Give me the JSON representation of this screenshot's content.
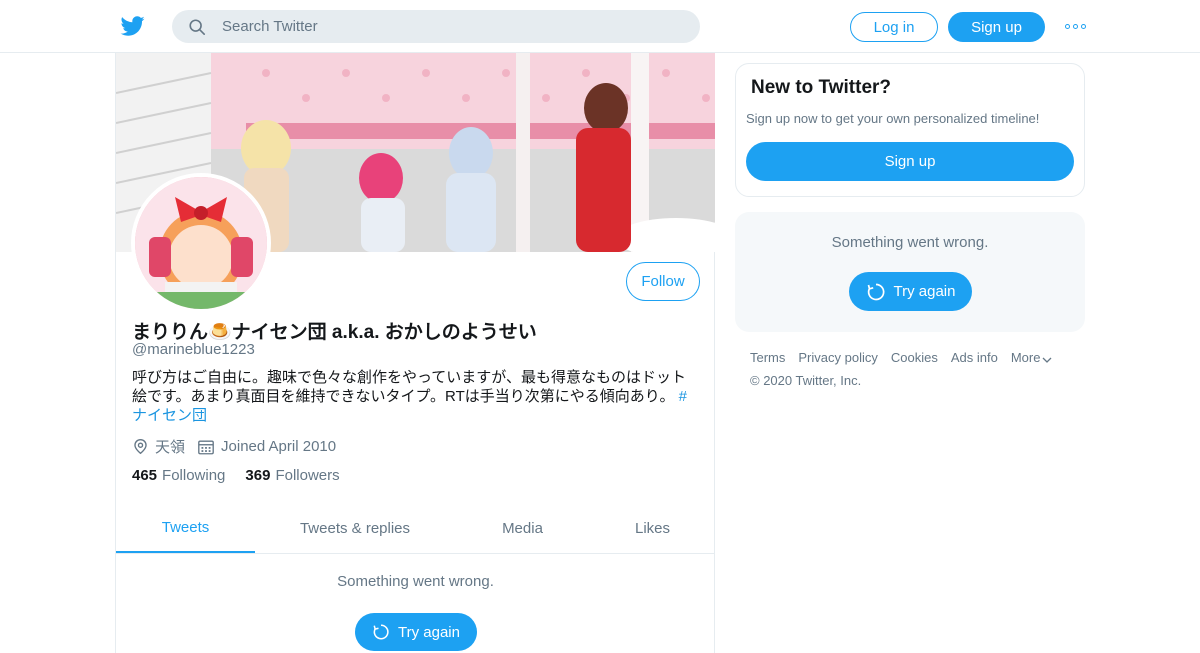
{
  "header": {
    "search_placeholder": "Search Twitter",
    "login_label": "Log in",
    "signup_label": "Sign up"
  },
  "profile": {
    "display_name": "まりりん🍮ナイセン団 a.k.a. おかしのようせい",
    "handle": "@marineblue1223",
    "bio_text": "呼び方はご自由に。趣味で色々な創作をやっていますが、最も得意なものはドット絵です。あまり真面目を維持できないタイプ。RTは手当り次第にやる傾向あり。",
    "bio_hashtag": "#ナイセン団",
    "location": "天領",
    "joined": "Joined April 2010",
    "following_count": "465",
    "following_label": "Following",
    "followers_count": "369",
    "followers_label": "Followers",
    "follow_label": "Follow"
  },
  "tabs": [
    {
      "label": "Tweets",
      "active": true
    },
    {
      "label": "Tweets & replies",
      "active": false
    },
    {
      "label": "Media",
      "active": false
    },
    {
      "label": "Likes",
      "active": false
    }
  ],
  "timeline": {
    "error_text": "Something went wrong.",
    "try_again_label": "Try again"
  },
  "sidebar": {
    "new_title": "New to Twitter?",
    "new_text": "Sign up now to get your own personalized timeline!",
    "signup_label": "Sign up",
    "error_text": "Something went wrong.",
    "try_again_label": "Try again"
  },
  "footer": {
    "links": [
      "Terms",
      "Privacy policy",
      "Cookies",
      "Ads info",
      "More"
    ],
    "copyright": "© 2020 Twitter, Inc."
  },
  "colors": {
    "accent": "#1da1f2",
    "secondary_text": "#657786",
    "border": "#e6ecf0"
  },
  "icons": [
    "twitter-logo-icon",
    "search-icon",
    "more-icon",
    "location-icon",
    "calendar-icon",
    "refresh-icon",
    "chevron-down-icon"
  ]
}
